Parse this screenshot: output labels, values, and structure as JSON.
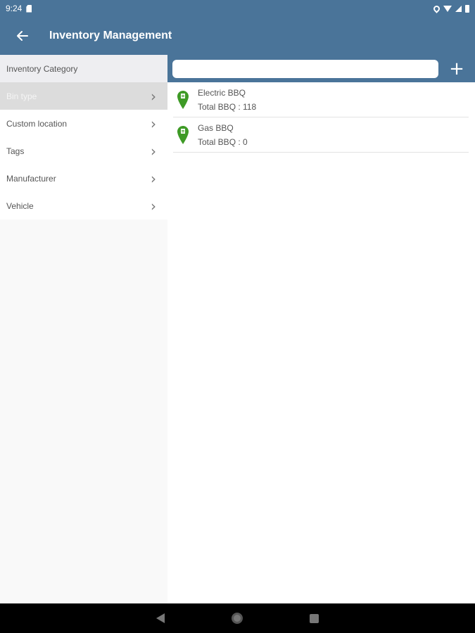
{
  "status_bar": {
    "time": "9:24"
  },
  "app_bar": {
    "title": "Inventory Management"
  },
  "left_panel": {
    "header": "Inventory Category",
    "items": [
      {
        "label": "Bin type"
      },
      {
        "label": "Custom location"
      },
      {
        "label": "Tags"
      },
      {
        "label": "Manufacturer"
      },
      {
        "label": "Vehicle"
      }
    ]
  },
  "search": {
    "value": "",
    "placeholder": ""
  },
  "right_list": {
    "items": [
      {
        "name": "Electric BBQ",
        "detail": "Total BBQ : 118"
      },
      {
        "name": "Gas BBQ",
        "detail": "Total BBQ : 0"
      }
    ]
  },
  "colors": {
    "primary": "#4a7499",
    "pin_green": "#3e9a26"
  },
  "icons": [
    "sd-card-icon",
    "location-icon",
    "wifi-icon",
    "signal-icon",
    "battery-icon",
    "back-arrow-icon",
    "chevron-right-icon",
    "add-icon",
    "map-pin-icon",
    "nav-back-icon",
    "nav-home-icon",
    "nav-recents-icon"
  ]
}
